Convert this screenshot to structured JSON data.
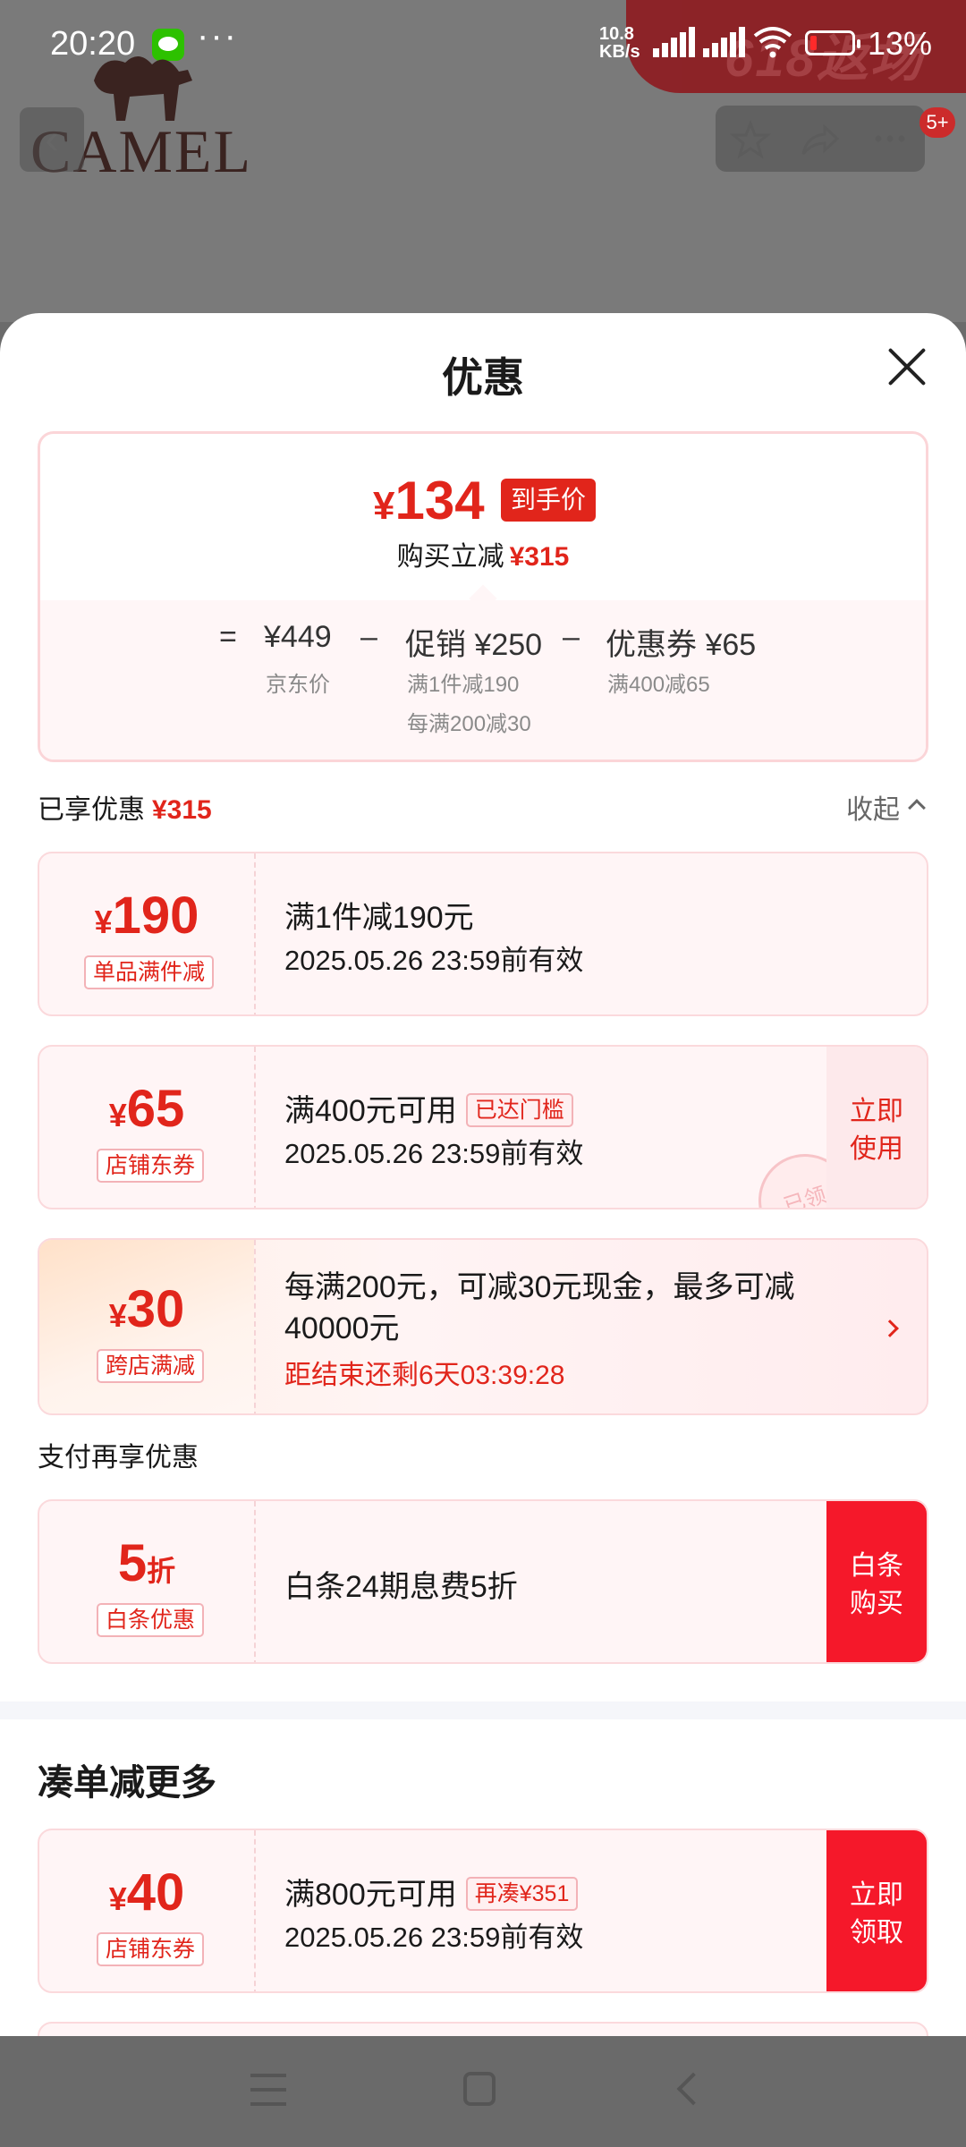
{
  "status_bar": {
    "time": "20:20",
    "more": "···",
    "net_speed_value": "10.8",
    "net_speed_unit": "KB/s",
    "battery": "13%",
    "banner_text": "618返场"
  },
  "background": {
    "logo": "CAMEL",
    "badge": "5+"
  },
  "sheet": {
    "title": "优惠",
    "price": {
      "currency": "¥",
      "final": "134",
      "final_tag": "到手价",
      "instant_cut_label": "购买立减",
      "instant_cut_amount": "¥315",
      "equals": "=",
      "jd_price": "¥449",
      "jd_price_label": "京东价",
      "minus": "–",
      "promo": "促销 ¥250",
      "promo_sub1": "满1件减190",
      "promo_sub2": "每满200减30",
      "coupon": "优惠券 ¥65",
      "coupon_sub": "满400减65"
    },
    "enjoyed_label": "已享优惠",
    "enjoyed_amount": "¥315",
    "collapse_label": "收起",
    "coupons": [
      {
        "currency": "¥",
        "amount": "190",
        "type": "单品满件减",
        "line1": "满1件减190元",
        "line2": "2025.05.26 23:59前有效"
      },
      {
        "currency": "¥",
        "amount": "65",
        "type": "店铺东券",
        "line1": "满400元可用",
        "tag": "已达门槛",
        "line2": "2025.05.26 23:59前有效",
        "action": "立即使用",
        "stamp": "已领"
      },
      {
        "currency": "¥",
        "amount": "30",
        "type": "跨店满减",
        "line1": "每满200元，可减30元现金，最多可减40000元",
        "countdown": "距结束还剩6天03:39:28"
      }
    ],
    "pay_section_label": "支付再享优惠",
    "pay_coupon": {
      "amount": "5",
      "suffix": "折",
      "type": "白条优惠",
      "line1": "白条24期息费5折",
      "action": "白条购买"
    },
    "more_section_title": "凑单减更多",
    "more_coupon": {
      "currency": "¥",
      "amount": "40",
      "type": "店铺东券",
      "line1": "满800元可用",
      "tag": "再凑¥351",
      "line2": "2025.05.26 23:59前有效",
      "action": "立即领取"
    }
  },
  "colors": {
    "accent": "#e1251b",
    "button_red": "#f5182a"
  },
  "icons": [
    "wechat-icon",
    "wifi-icon",
    "battery-icon",
    "back-icon",
    "star-icon",
    "share-icon",
    "more-icon",
    "close-icon",
    "chevron-up-icon",
    "chevron-right-icon",
    "menu-icon",
    "home-icon",
    "nav-back-icon"
  ]
}
